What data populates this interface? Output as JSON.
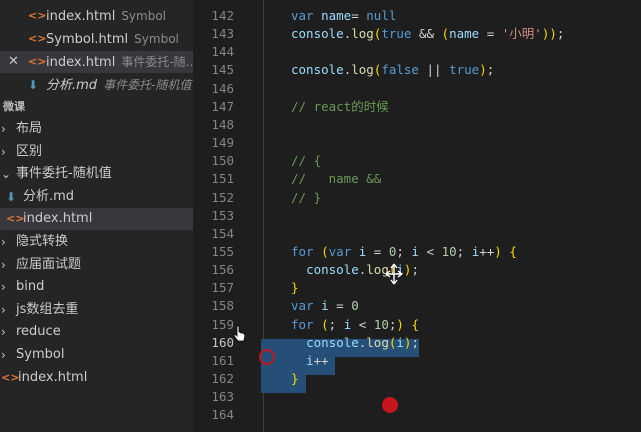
{
  "open_editors": [
    {
      "name": "index.html",
      "hint": "Symbol",
      "icon": "html-file-icon"
    },
    {
      "name": "Symbol.html",
      "hint": "Symbol",
      "icon": "html-file-icon"
    },
    {
      "name": "index.html",
      "hint": "事件委托-随...",
      "icon": "html-file-icon",
      "close": "✕"
    },
    {
      "name": "分析.md",
      "hint": "事件委托-随机值",
      "icon": "markdown-file-icon"
    }
  ],
  "explorer": {
    "section_title": "微课",
    "items": [
      {
        "name": "布局",
        "type": "folder",
        "chevron": "›"
      },
      {
        "name": "区别",
        "type": "folder",
        "chevron": "›"
      },
      {
        "name": "事件委托-随机值",
        "type": "folder",
        "chevron": "⌄"
      },
      {
        "name": "分析.md",
        "type": "file",
        "icon": "markdown-file-icon"
      },
      {
        "name": "index.html",
        "type": "file",
        "icon": "html-file-icon"
      },
      {
        "name": "隐式转换",
        "type": "folder",
        "chevron": "›"
      },
      {
        "name": "应届面试题",
        "type": "folder",
        "chevron": "›"
      },
      {
        "name": "bind",
        "type": "folder",
        "chevron": "›"
      },
      {
        "name": "js数组去重",
        "type": "folder",
        "chevron": "›"
      },
      {
        "name": "reduce",
        "type": "folder",
        "chevron": "›"
      },
      {
        "name": "Symbol",
        "type": "folder",
        "chevron": "›"
      },
      {
        "name": "index.html",
        "type": "file",
        "icon": "html-file-icon"
      }
    ]
  },
  "editor": {
    "active_line": "160",
    "lines": [
      {
        "n": "142",
        "tokens": [
          [
            "kw",
            "var "
          ],
          [
            "vr",
            "name"
          ],
          [
            "",
            "= "
          ],
          [
            "kw",
            "null"
          ]
        ]
      },
      {
        "n": "143",
        "tokens": [
          [
            "vr",
            "console"
          ],
          [
            "",
            "."
          ],
          [
            "fn",
            "log"
          ],
          [
            "pn",
            "("
          ],
          [
            "kw",
            "true"
          ],
          [
            "",
            " && "
          ],
          [
            "pn",
            "("
          ],
          [
            "vr",
            "name"
          ],
          [
            "",
            " = "
          ],
          [
            "str",
            "'小明'"
          ],
          [
            "pn",
            "))"
          ],
          [
            "",
            ";"
          ]
        ]
      },
      {
        "n": "144",
        "tokens": []
      },
      {
        "n": "145",
        "tokens": [
          [
            "vr",
            "console"
          ],
          [
            "",
            "."
          ],
          [
            "fn",
            "log"
          ],
          [
            "pn",
            "("
          ],
          [
            "kw",
            "false"
          ],
          [
            "",
            " || "
          ],
          [
            "kw",
            "true"
          ],
          [
            "pn",
            ")"
          ],
          [
            "",
            ";"
          ]
        ]
      },
      {
        "n": "146",
        "tokens": []
      },
      {
        "n": "147",
        "tokens": [
          [
            "cm",
            "// react的时候"
          ]
        ]
      },
      {
        "n": "148",
        "tokens": []
      },
      {
        "n": "149",
        "tokens": []
      },
      {
        "n": "150",
        "tokens": [
          [
            "cm",
            "// {"
          ]
        ]
      },
      {
        "n": "151",
        "tokens": [
          [
            "cm",
            "//   name &&"
          ]
        ]
      },
      {
        "n": "152",
        "tokens": [
          [
            "cm",
            "// }"
          ]
        ]
      },
      {
        "n": "153",
        "tokens": []
      },
      {
        "n": "154",
        "tokens": []
      },
      {
        "n": "155",
        "tokens": [
          [
            "kw",
            "for "
          ],
          [
            "pn",
            "("
          ],
          [
            "kw",
            "var "
          ],
          [
            "vr",
            "i"
          ],
          [
            "",
            " = "
          ],
          [
            "num",
            "0"
          ],
          [
            "",
            "; "
          ],
          [
            "vr",
            "i"
          ],
          [
            "",
            " < "
          ],
          [
            "num",
            "10"
          ],
          [
            "",
            "; "
          ],
          [
            "vr",
            "i"
          ],
          [
            "",
            "++"
          ],
          [
            "pn",
            ")"
          ],
          [
            "",
            " "
          ],
          [
            "pn",
            "{"
          ]
        ]
      },
      {
        "n": "156",
        "tokens": [
          [
            "",
            "  "
          ],
          [
            "vr",
            "console"
          ],
          [
            "",
            "."
          ],
          [
            "fn",
            "log"
          ],
          [
            "pn",
            "("
          ],
          [
            "vr",
            "i"
          ],
          [
            "pn",
            ")"
          ],
          [
            "",
            ";"
          ]
        ]
      },
      {
        "n": "157",
        "tokens": [
          [
            "pn",
            "}"
          ]
        ]
      },
      {
        "n": "158",
        "tokens": [
          [
            "kw",
            "var "
          ],
          [
            "vr",
            "i"
          ],
          [
            "",
            " = "
          ],
          [
            "num",
            "0"
          ]
        ]
      },
      {
        "n": "159",
        "tokens": [
          [
            "kw",
            "for "
          ],
          [
            "pn",
            "("
          ],
          [
            "",
            "; "
          ],
          [
            "vr",
            "i"
          ],
          [
            "",
            " < "
          ],
          [
            "num",
            "10"
          ],
          [
            "",
            ";"
          ],
          [
            "pn",
            ")"
          ],
          [
            "",
            " "
          ],
          [
            "pn",
            "{"
          ]
        ]
      },
      {
        "n": "160",
        "tokens": [
          [
            "",
            "  "
          ],
          [
            "vr",
            "console"
          ],
          [
            "",
            "."
          ],
          [
            "fn",
            "log"
          ],
          [
            "pn",
            "("
          ],
          [
            "vr",
            "i"
          ],
          [
            "pn",
            ")"
          ],
          [
            "",
            ";"
          ]
        ]
      },
      {
        "n": "161",
        "tokens": [
          [
            "",
            "  "
          ],
          [
            "vr",
            "i"
          ],
          [
            "",
            "++"
          ]
        ]
      },
      {
        "n": "162",
        "tokens": [
          [
            "pn",
            "}"
          ]
        ]
      },
      {
        "n": "163",
        "tokens": []
      },
      {
        "n": "164",
        "tokens": []
      }
    ]
  },
  "colors": {
    "sidebar_bg": "#252526",
    "editor_bg": "#1e1e1e",
    "selection": "#264f78",
    "cursor_dot": "#c4161c"
  }
}
